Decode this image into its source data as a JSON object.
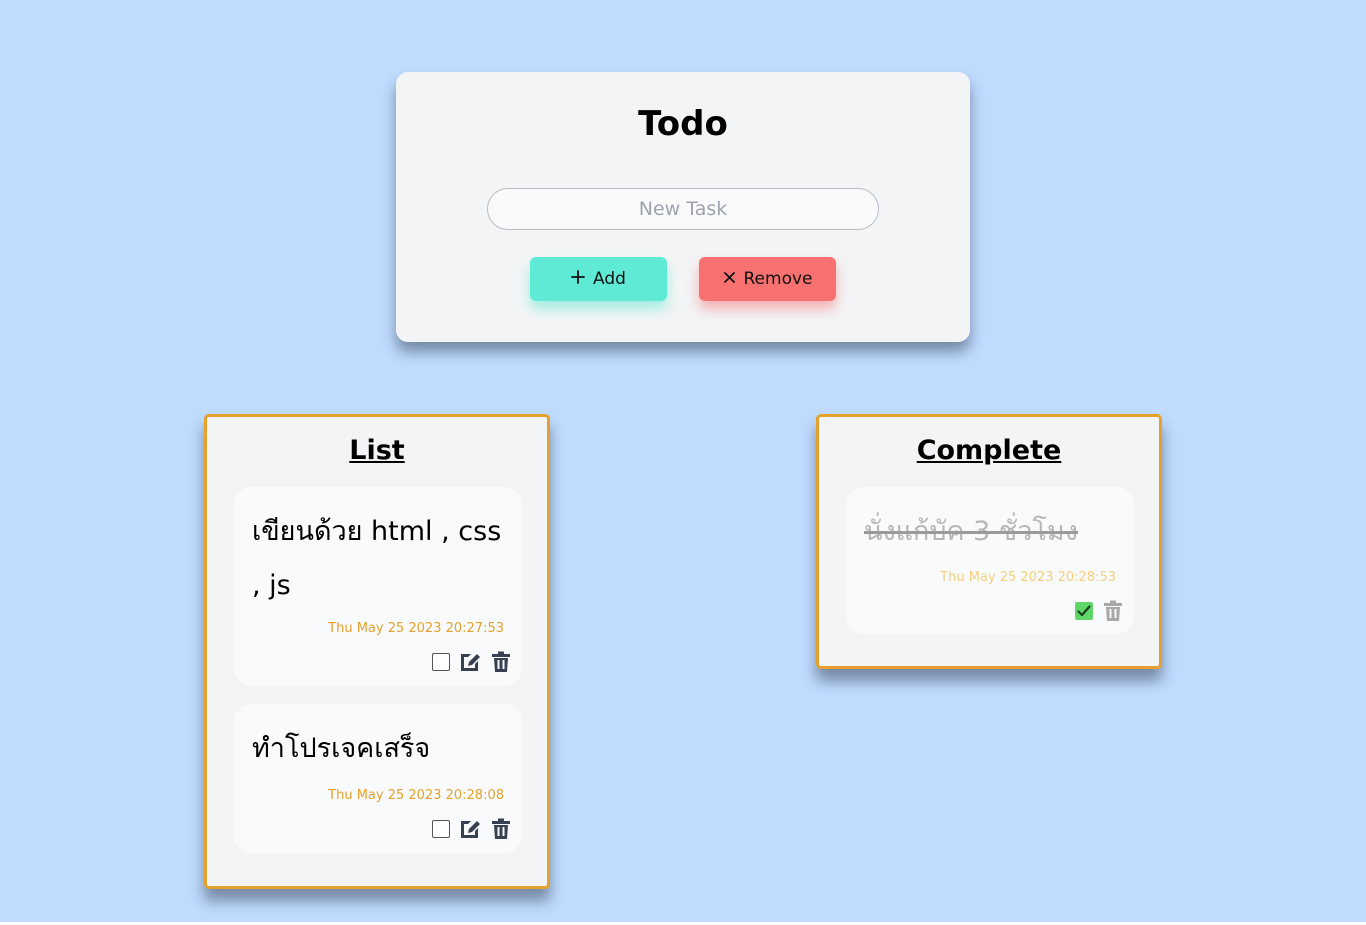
{
  "app": {
    "title": "Todo"
  },
  "input": {
    "placeholder": "New Task",
    "value": ""
  },
  "buttons": {
    "add_icon": "plus-icon",
    "add_label": "Add",
    "remove_icon": "times-icon",
    "remove_label": "Remove"
  },
  "colors": {
    "background": "#bfdbfe",
    "add_button": "#5eead4",
    "remove_button": "#f87171",
    "panel_border": "#e5a12b",
    "date_text": "#e5a12b",
    "checked": "#5ed668"
  },
  "list": {
    "title": "List",
    "items": [
      {
        "text": "เขียนด้วย html , css , js",
        "date": "Thu May 25 2023 20:27:53",
        "checked": false
      },
      {
        "text": "ทำโปรเจคเสร็จ",
        "date": "Thu May 25 2023 20:28:08",
        "checked": false
      }
    ]
  },
  "complete": {
    "title": "Complete",
    "items": [
      {
        "text": "นั่งแก้บัค 3 ชั่วโมง",
        "date": "Thu May 25 2023 20:28:53",
        "checked": true
      }
    ]
  }
}
